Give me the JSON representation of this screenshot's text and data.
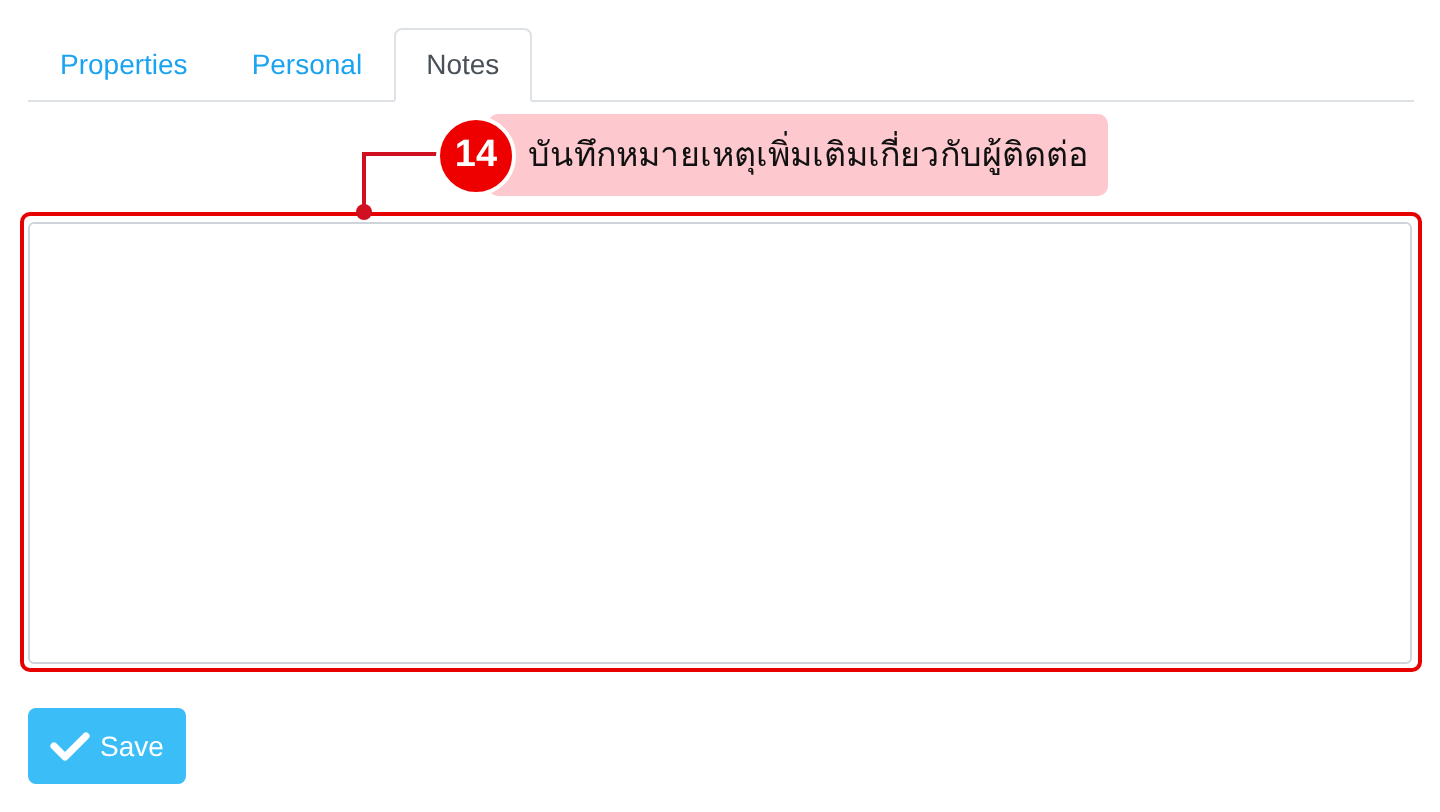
{
  "tabs": [
    {
      "label": "Properties",
      "selected": false
    },
    {
      "label": "Personal",
      "selected": false
    },
    {
      "label": "Notes",
      "selected": true
    }
  ],
  "callout": {
    "number": "14",
    "text": "บันทึกหมายเหตุเพิ่มเติมเกี่ยวกับผู้ติดต่อ"
  },
  "save_button": {
    "label": "Save"
  }
}
